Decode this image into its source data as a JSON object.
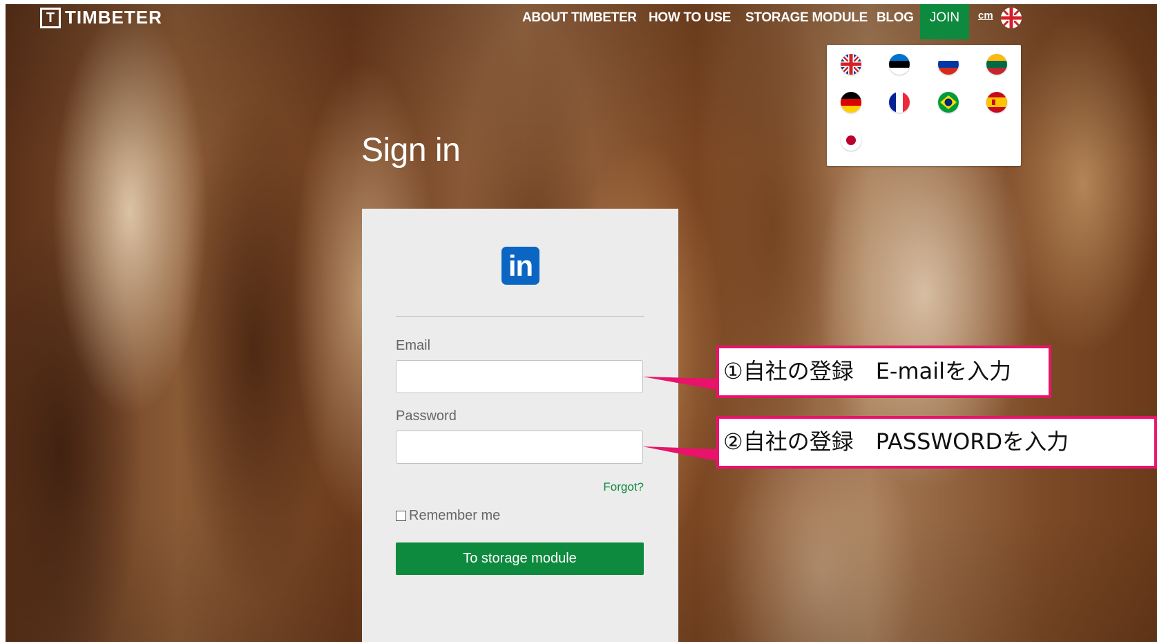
{
  "header": {
    "logo_mark": "T",
    "logo_text": "TIMBETER",
    "nav": [
      "ABOUT TIMBETER",
      "HOW TO USE",
      "STORAGE MODULE",
      "BLOG"
    ],
    "join_label": "JOIN",
    "unit_toggle": "cm",
    "current_language_flag": "uk-flag-icon"
  },
  "language_menu": {
    "flags": [
      "uk-flag-icon",
      "estonia-flag-icon",
      "russia-flag-icon",
      "lithuania-flag-icon",
      "germany-flag-icon",
      "france-flag-icon",
      "brazil-flag-icon",
      "spain-flag-icon",
      "japan-flag-icon"
    ]
  },
  "page": {
    "title": "Sign in",
    "brand_icon": "linkedin-icon",
    "brand_icon_text": "in",
    "email_label": "Email",
    "email_value": "",
    "password_label": "Password",
    "password_value": "",
    "forgot_label": "Forgot?",
    "remember_label": "Remember me",
    "remember_checked": false,
    "submit_label": "To storage module"
  },
  "annotations": {
    "email_callout": "①自社の登録　E-mailを入力",
    "password_callout": "②自社の登録　PASSWORDを入力",
    "callout_color": "#e8136a"
  },
  "colors": {
    "accent_green": "#0e8a3e",
    "linkedin_blue": "#0a66c2"
  }
}
